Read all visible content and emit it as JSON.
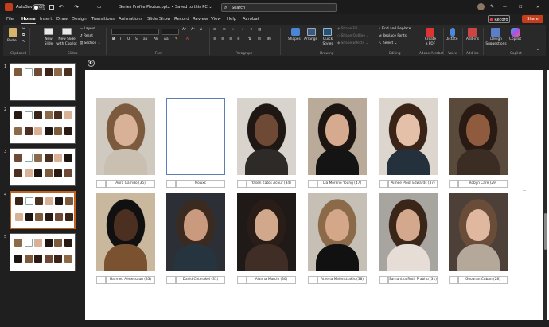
{
  "titlebar": {
    "autosave_label": "AutoSave",
    "autosave_state": "Off",
    "doc_title": "Series Profile Photos.pptx • Saved to this PC ⌄",
    "search_placeholder": "Search",
    "record_label": "Record",
    "share_label": "Share",
    "share_color": "#c43e1c"
  },
  "tabs": [
    "File",
    "Home",
    "Insert",
    "Draw",
    "Design",
    "Transitions",
    "Animations",
    "Slide Show",
    "Record",
    "Review",
    "View",
    "Help",
    "Acrobat"
  ],
  "active_tab": "Home",
  "ribbon": {
    "paste_label": "Paste",
    "new_slide_label": "New Slide",
    "new_slide_copilot_label": "New Slide with Copilot",
    "layout_label": "Layout",
    "reset_label": "Reset",
    "section_label": "Section",
    "shapes_label": "Shapes",
    "arrange_label": "Arrange",
    "quick_styles_label": "Quick Styles",
    "shape_fill_label": "Shape Fill",
    "shape_outline_label": "Shape Outline",
    "shape_effects_label": "Shape Effects",
    "find_replace_label": "Find and Replace",
    "replace_fonts_label": "Replace Fonts",
    "select_label": "Select",
    "create_pdf_label": "Create a PDF",
    "dictate_label": "Dictate",
    "addins_label": "Add-ins",
    "design_suggestions_label": "Design Suggestions",
    "copilot_label": "Copilot",
    "groups": {
      "clipboard": "Clipboard",
      "slides": "Slides",
      "font": "Font",
      "paragraph": "Paragraph",
      "drawing": "Drawing",
      "editing": "Editing",
      "adobe": "Adobe Acrobat",
      "voice": "Voice",
      "addins": "Add-ins",
      "copilot": "Copilot"
    }
  },
  "slide_numbers": [
    "1",
    "2",
    "3",
    "4",
    "5"
  ],
  "selected_slide": 4,
  "slide": {
    "row1": [
      {
        "caption": "Aura Garrido (35)",
        "hair": "#7b5a3d",
        "skin": "#d9b196",
        "body": "#c9c0b2",
        "bg": "#cfc9bf"
      },
      {
        "caption": "Nowxc",
        "placeholder": true
      },
      {
        "caption": "Yasen Zatos Acour (34)",
        "hair": "#1e1713",
        "skin": "#6e4a36",
        "body": "#2d2a28",
        "bg": "#d8d3cc"
      },
      {
        "caption": "Lia Moreno Young (47)",
        "hair": "#1c1512",
        "skin": "#d6aa8f",
        "body": "#151414",
        "bg": "#b9aa9a"
      },
      {
        "caption": "Aimee Ploof Edwards (37)",
        "hair": "#3a2418",
        "skin": "#e5c0a8",
        "body": "#24303c",
        "bg": "#dcd6cf"
      },
      {
        "caption": "Robyn Care (29)",
        "hair": "#2a1a14",
        "skin": "#8e5b3f",
        "body": "#3b2c24",
        "bg": "#5a4a3c"
      }
    ],
    "row2": [
      {
        "caption": "Harmed Almessaun (33)",
        "hair": "#101010",
        "skin": "#4b3022",
        "body": "#7a5230",
        "bg": "#c9b89d"
      },
      {
        "caption": "David Coterakel (31)",
        "hair": "#3a2a1f",
        "skin": "#c99a7e",
        "body": "#26343f",
        "bg": "#2c3036"
      },
      {
        "caption": "Alanna Marcio (30)",
        "hair": "#2a1c16",
        "skin": "#d1a88c",
        "body": "#402e26",
        "bg": "#1f1a17"
      },
      {
        "caption": "Athena Melonstrakis (38)",
        "hair": "#8a6a48",
        "skin": "#d3a788",
        "body": "#111111",
        "bg": "#c6bfb5"
      },
      {
        "caption": "Samantha Ruth Prabhu (31)",
        "hair": "#3a2519",
        "skin": "#d4a88c",
        "body": "#e6ded6",
        "bg": "#a8a49f"
      },
      {
        "caption": "Gooaran Cuban (28)",
        "hair": "#6a4d38",
        "skin": "#e0b8a0",
        "body": "#b4a89a",
        "bg": "#4c4038"
      }
    ],
    "row1_label_right": ""
  }
}
